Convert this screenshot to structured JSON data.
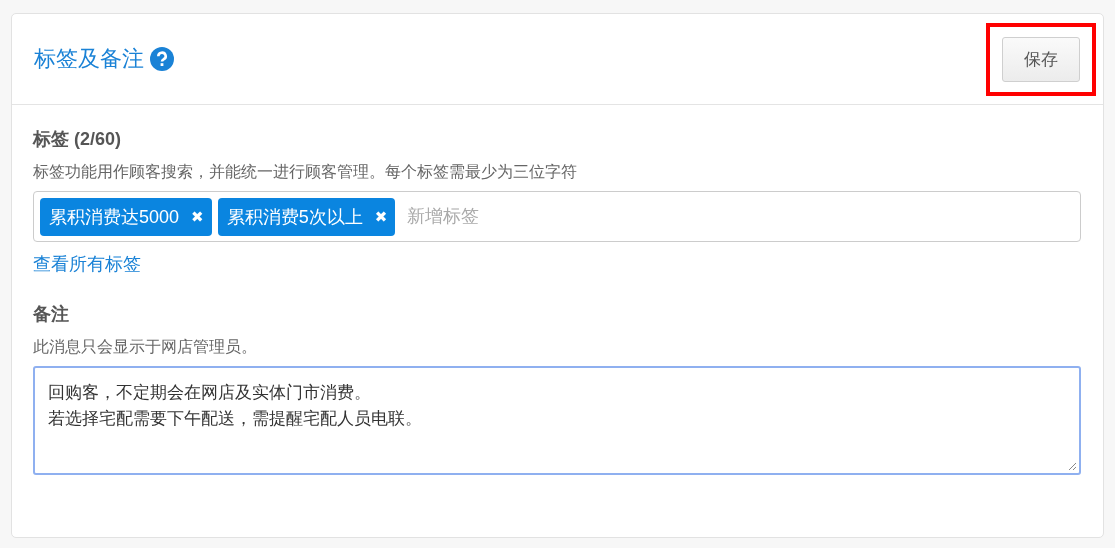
{
  "panel": {
    "title": "标签及备注",
    "save_button": {
      "label": "保存",
      "highlighted": true
    }
  },
  "tags_section": {
    "label": "标签 (2/60)",
    "description": "标签功能用作顾客搜索，并能统一进行顾客管理。每个标签需最少为三位字符",
    "tags": [
      {
        "label": "累积消费达5000",
        "remove": "✖"
      },
      {
        "label": "累积消费5次以上",
        "remove": "✖"
      }
    ],
    "input": {
      "placeholder": "新增标签"
    },
    "link": "查看所有标签"
  },
  "notes_section": {
    "label": "备注",
    "description": "此消息只会显示于网店管理员。",
    "lines": [
      "回购客，不定期会在网店及实体门市消费。",
      "若选择宅配需要下午配送，需提醒宅配人员电联。"
    ],
    "focused": true
  }
}
